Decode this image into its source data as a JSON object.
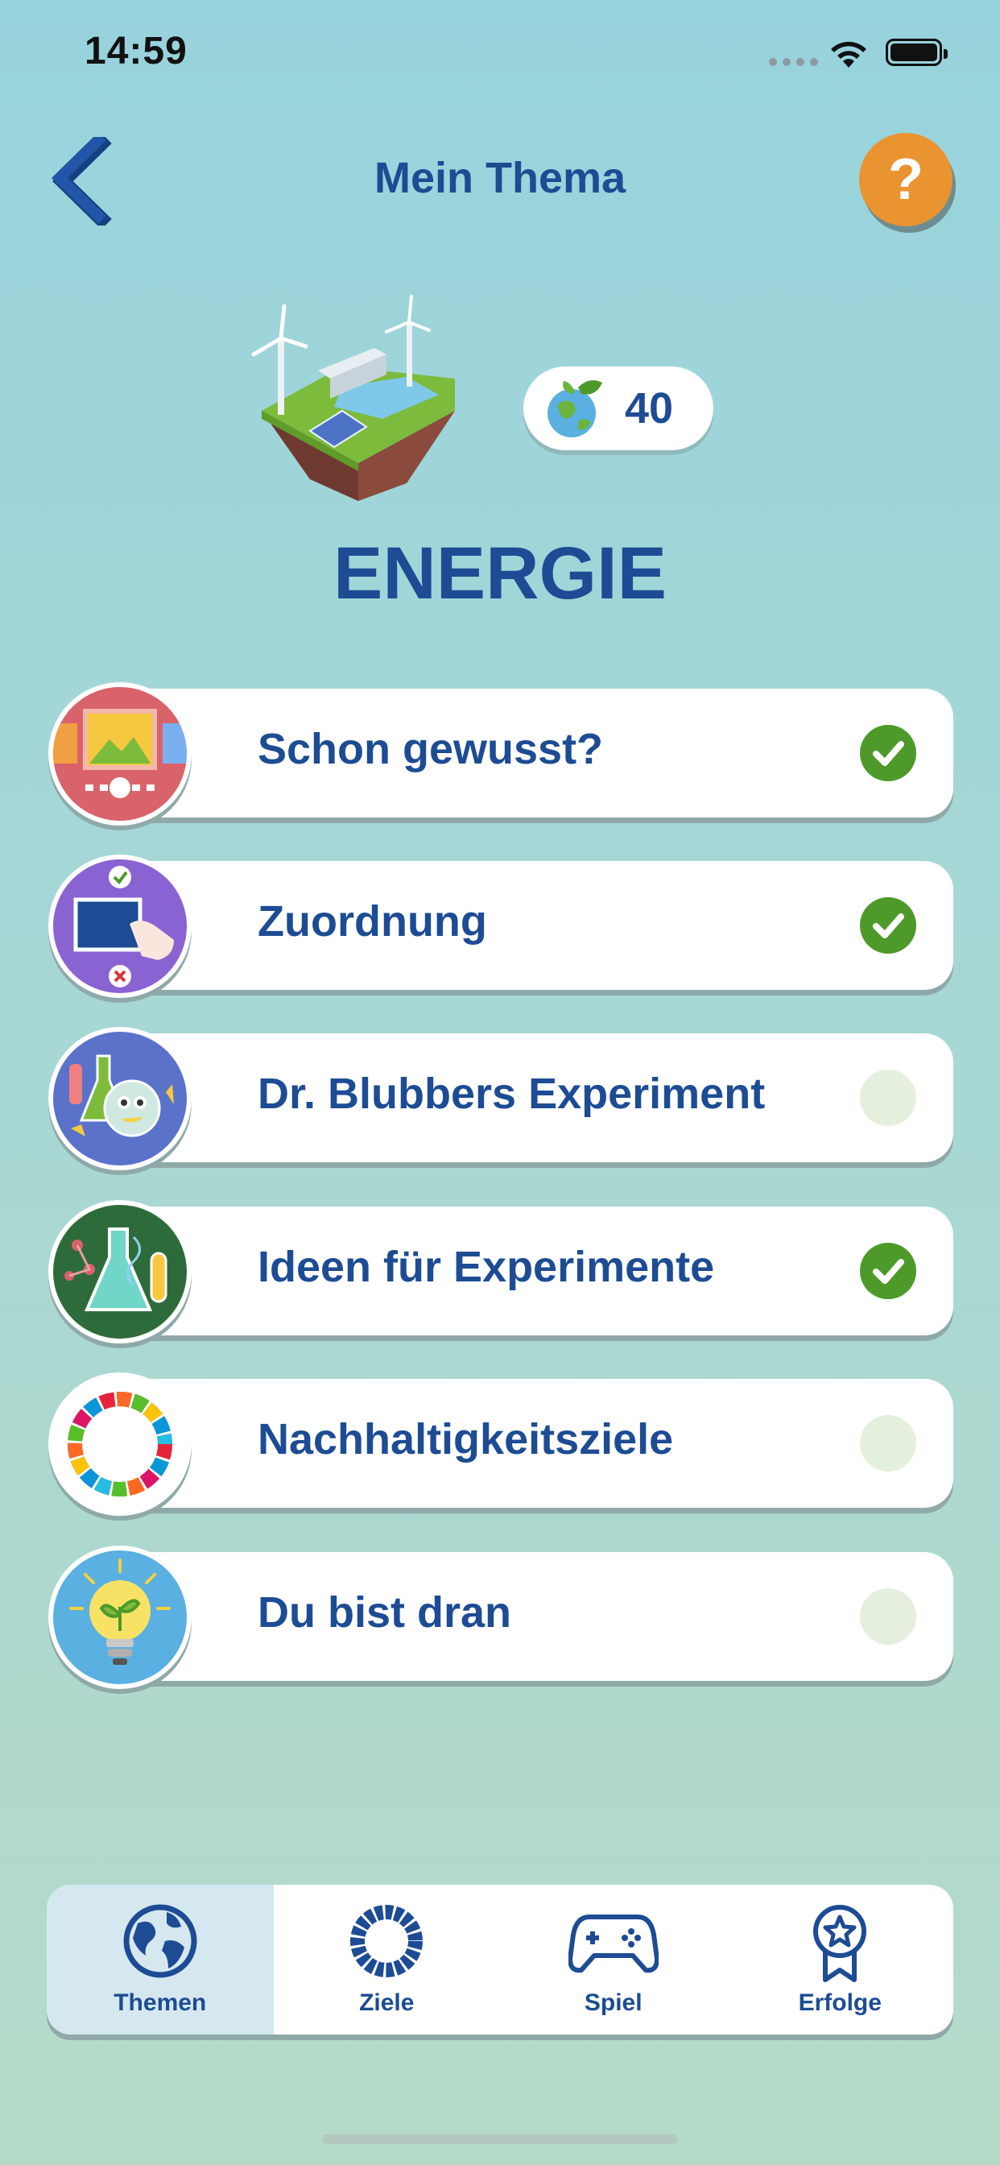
{
  "status_bar": {
    "time": "14:59"
  },
  "header": {
    "title": "Mein Thema",
    "back_icon": "chevron-left-icon",
    "help_label": "?"
  },
  "topic": {
    "name": "ENERGIE",
    "points": "40",
    "illustration": "floating-energy-island"
  },
  "activities": [
    {
      "label": "Schon gewusst?",
      "icon": "slideshow-icon",
      "completed": true,
      "icon_bg": "#d9636b"
    },
    {
      "label": "Zuordnung",
      "icon": "matching-drag-icon",
      "completed": true,
      "icon_bg": "#8a63d2"
    },
    {
      "label": "Dr. Blubbers Experiment",
      "icon": "lab-character-icon",
      "completed": false,
      "icon_bg": "#5a72c9"
    },
    {
      "label": "Ideen für Experimente",
      "icon": "flask-dna-icon",
      "completed": true,
      "icon_bg": "#2e6b3a"
    },
    {
      "label": "Nachhaltigkeitsziele",
      "icon": "sdg-wheel-icon",
      "completed": false,
      "icon_bg": "#ffffff"
    },
    {
      "label": "Du bist dran",
      "icon": "lightbulb-plant-icon",
      "completed": false,
      "icon_bg": "#5ab0e0"
    }
  ],
  "tabbar": {
    "tabs": [
      {
        "label": "Themen",
        "icon": "globe-icon",
        "active": true
      },
      {
        "label": "Ziele",
        "icon": "goals-wheel-icon",
        "active": false
      },
      {
        "label": "Spiel",
        "icon": "gamepad-icon",
        "active": false
      },
      {
        "label": "Erfolge",
        "icon": "award-icon",
        "active": false
      }
    ]
  },
  "colors": {
    "primary": "#1d4c94",
    "accent": "#e99331",
    "done": "#4d9a2a",
    "todo": "#e4efde"
  }
}
